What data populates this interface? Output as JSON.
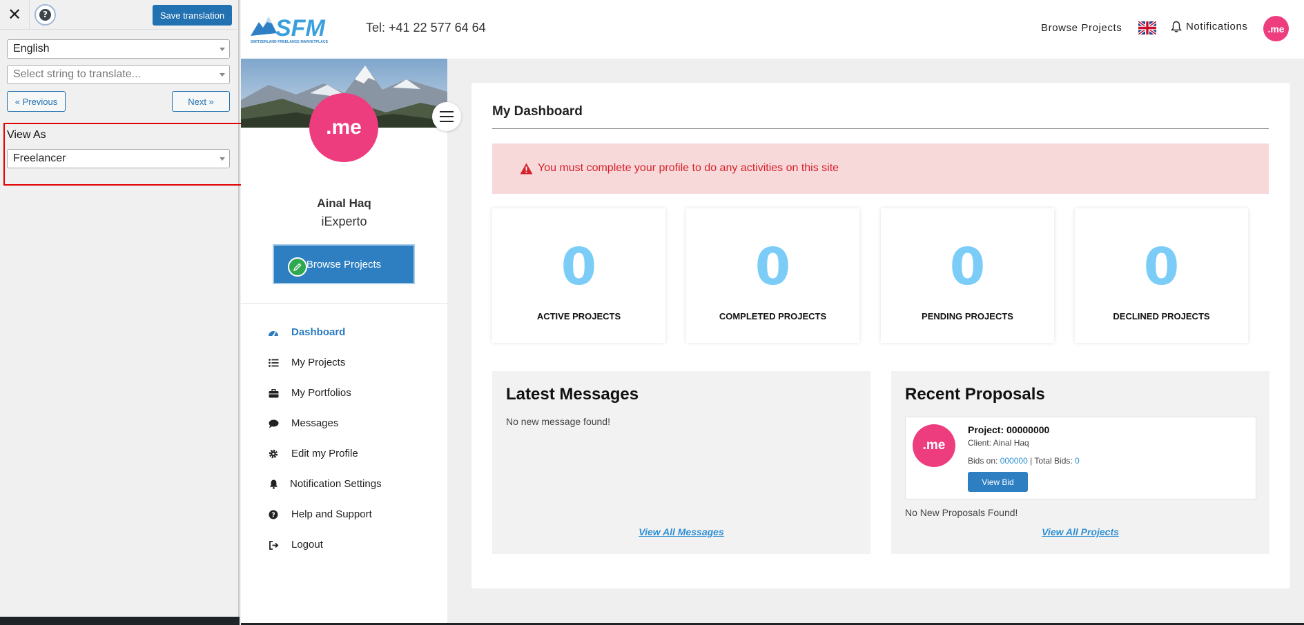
{
  "translation_panel": {
    "save_label": "Save translation",
    "language": "English",
    "string_placeholder": "Select string to translate...",
    "prev_label": "« Previous",
    "next_label": "Next »",
    "view_as_label": "View As",
    "view_as_value": "Freelancer"
  },
  "header": {
    "logo_text": "SFM",
    "logo_tagline": "SWITZERLAND FREELANCE MARKETPLACE",
    "phone": "Tel: +41 22 577 64 64",
    "browse_projects": "Browse Projects",
    "notifications": "Notifications",
    "avatar_text": ".me",
    "flag_icon": "uk-flag-icon"
  },
  "profile": {
    "avatar_text": ".me",
    "name": "Ainal Haq",
    "org": "iExperto",
    "browse_button": "Browse Projects",
    "menu": [
      {
        "label": "Dashboard",
        "icon": "dashboard-icon"
      },
      {
        "label": "My Projects",
        "icon": "list-icon"
      },
      {
        "label": "My Portfolios",
        "icon": "briefcase-icon"
      },
      {
        "label": "Messages",
        "icon": "chat-bubble-icon"
      },
      {
        "label": "Edit my Profile",
        "icon": "gear-icon"
      },
      {
        "label": "Notification Settings",
        "icon": "bell-icon"
      },
      {
        "label": "Help and Support",
        "icon": "question-icon"
      },
      {
        "label": "Logout",
        "icon": "logout-icon"
      }
    ]
  },
  "dashboard": {
    "title": "My Dashboard",
    "alert": "You must complete your profile to do any activities on this site",
    "stats": [
      {
        "value": "0",
        "label": "ACTIVE PROJECTS"
      },
      {
        "value": "0",
        "label": "COMPLETED PROJECTS"
      },
      {
        "value": "0",
        "label": "PENDING PROJECTS"
      },
      {
        "value": "0",
        "label": "DECLINED PROJECTS"
      }
    ],
    "messages": {
      "title": "Latest Messages",
      "empty": "No new message found!",
      "view_all": "View All Messages"
    },
    "proposals": {
      "title": "Recent Proposals",
      "item": {
        "avatar_text": ".me",
        "project": "Project: 00000000",
        "client": "Client: Ainal Haq",
        "bids_on_label": "Bids on:",
        "bids_on_value": "000000",
        "separator": "|",
        "total_bids_label": "Total Bids:",
        "total_bids_value": "0",
        "view_bid": "View Bid"
      },
      "empty": "No New Proposals Found!",
      "view_all": "View All Projects"
    }
  },
  "colors": {
    "accent_blue": "#2d7fc1",
    "wp_blue": "#2271b1",
    "brand_pink": "#ee3d7e",
    "stat_number": "#7bcdf8",
    "alert_bg": "#f8d9da",
    "alert_text": "#d4212b",
    "highlight_red": "#e10000"
  }
}
